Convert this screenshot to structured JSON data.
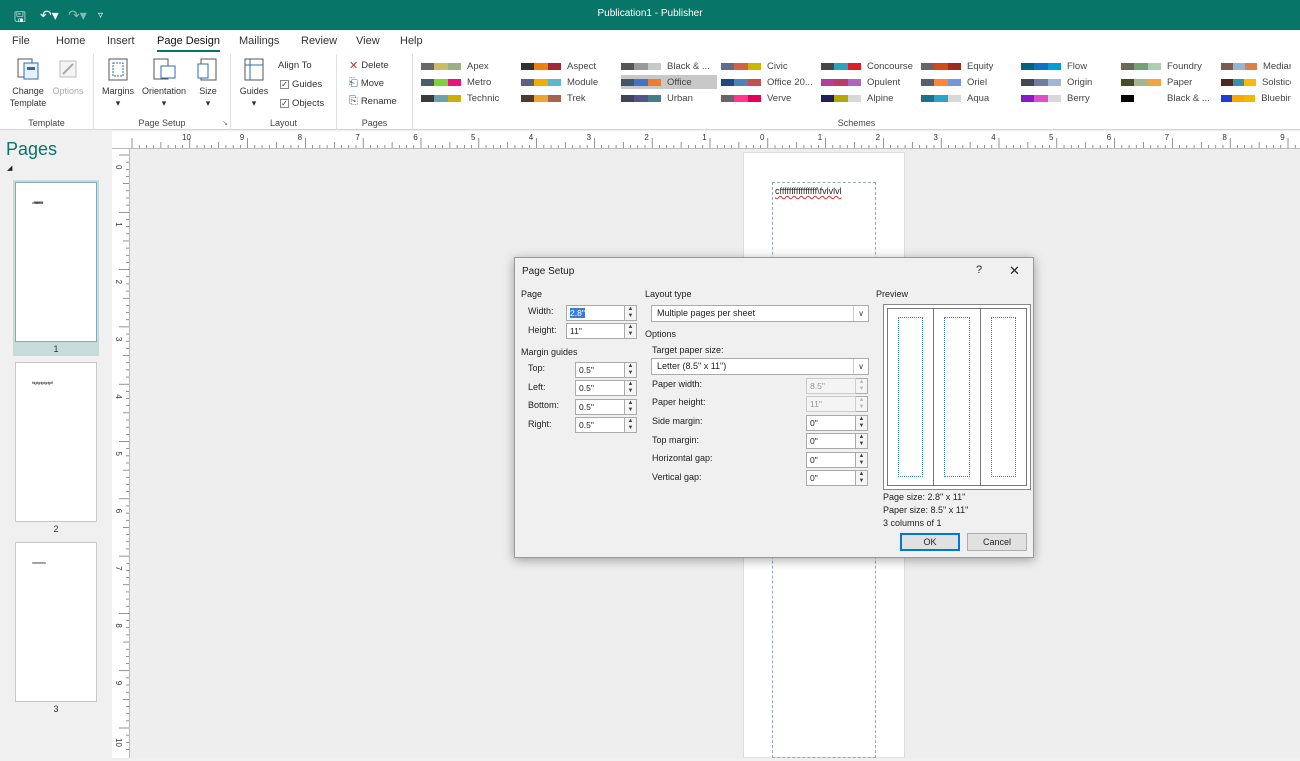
{
  "app": {
    "title": "Publication1 - Publisher"
  },
  "menu": {
    "tabs": [
      "File",
      "Home",
      "Insert",
      "Page Design",
      "Mailings",
      "Review",
      "View",
      "Help"
    ],
    "active": "Page Design"
  },
  "ribbon": {
    "template": {
      "change": "Change",
      "change2": "Template",
      "options": "Options",
      "label": "Template"
    },
    "page_setup": {
      "margins": "Margins",
      "orientation": "Orientation",
      "size": "Size",
      "label": "Page Setup"
    },
    "layout": {
      "guides": "Guides",
      "align_to": "Align To",
      "guides_chk": "Guides",
      "objects": "Objects",
      "label": "Layout"
    },
    "pages": {
      "delete": "Delete",
      "move": "Move",
      "rename": "Rename",
      "label": "Pages"
    },
    "schemes": {
      "label": "Schemes",
      "items": [
        {
          "name": "Apex",
          "colors": [
            "#69676d",
            "#ceb966",
            "#9cb084"
          ]
        },
        {
          "name": "Aspect",
          "colors": [
            "#323232",
            "#f07f09",
            "#9f2936"
          ]
        },
        {
          "name": "Black & ...",
          "colors": [
            "#555555",
            "#999999",
            "#c9c9c9"
          ]
        },
        {
          "name": "Civic",
          "colors": [
            "#646b86",
            "#d16349",
            "#ccb400"
          ]
        },
        {
          "name": "Concourse",
          "colors": [
            "#464646",
            "#2da2bf",
            "#da1f28"
          ]
        },
        {
          "name": "Equity",
          "colors": [
            "#696464",
            "#d34817",
            "#9b2d1f"
          ]
        },
        {
          "name": "Flow",
          "colors": [
            "#04617b",
            "#0f6fc6",
            "#009dd9"
          ]
        },
        {
          "name": "Foundry",
          "colors": [
            "#676a55",
            "#72a376",
            "#b0ccb0"
          ]
        },
        {
          "name": "Median",
          "colors": [
            "#775f55",
            "#94b6d2",
            "#dd8047"
          ]
        },
        {
          "name": "Metro",
          "colors": [
            "#4e5b6f",
            "#7fd13b",
            "#ea157a"
          ]
        },
        {
          "name": "Module",
          "colors": [
            "#5a6378",
            "#f0ad00",
            "#60b5cc"
          ]
        },
        {
          "name": "Office",
          "colors": [
            "#44546a",
            "#4472c4",
            "#ed7d31"
          ]
        },
        {
          "name": "Office 20...",
          "colors": [
            "#1f497d",
            "#4f81bd",
            "#c0504d"
          ]
        },
        {
          "name": "Opulent",
          "colors": [
            "#b13f9a",
            "#b83d68",
            "#ac66bb"
          ]
        },
        {
          "name": "Oriel",
          "colors": [
            "#575f6d",
            "#fe8637",
            "#7598d9"
          ]
        },
        {
          "name": "Origin",
          "colors": [
            "#464653",
            "#727ca3",
            "#9fb8cd"
          ]
        },
        {
          "name": "Paper",
          "colors": [
            "#444d26",
            "#a5b592",
            "#f3a447"
          ]
        },
        {
          "name": "Solstice",
          "colors": [
            "#4f271c",
            "#3891a7",
            "#feb80a"
          ]
        },
        {
          "name": "Technic",
          "colors": [
            "#3b3b3b",
            "#6ea0b0",
            "#ccaf0a"
          ]
        },
        {
          "name": "Trek",
          "colors": [
            "#4e3b30",
            "#f0a22e",
            "#a5644e"
          ]
        },
        {
          "name": "Urban",
          "colors": [
            "#424456",
            "#53548a",
            "#438086"
          ]
        },
        {
          "name": "Verve",
          "colors": [
            "#666666",
            "#ff388c",
            "#e40059"
          ]
        },
        {
          "name": "Alpine",
          "colors": [
            "#1f1f5c",
            "#b2a800",
            "#d8d8d8"
          ]
        },
        {
          "name": "Aqua",
          "colors": [
            "#1f6f8f",
            "#2ba4c9",
            "#d8d8d8"
          ]
        },
        {
          "name": "Berry",
          "colors": [
            "#8a1ac9",
            "#e04fc9",
            "#d8d8d8"
          ]
        },
        {
          "name": "Black & ...",
          "colors": [
            "#000000",
            "#ffffff",
            "#ffffff"
          ]
        },
        {
          "name": "Bluebird",
          "colors": [
            "#1e3cd8",
            "#f8a800",
            "#f0b800"
          ]
        }
      ],
      "selected": "Office"
    }
  },
  "pages_panel": {
    "title": "Pages",
    "pages": [
      {
        "num": "1",
        "text": "cfffffffffffffffff"
      },
      {
        "num": "2",
        "text": "fdgdgdgdgdgdf"
      },
      {
        "num": "3",
        "text": "xxxxxxxxx"
      }
    ]
  },
  "document": {
    "text": "cffffffffffffffff\\fvlvlvl"
  },
  "ruler": {
    "h": [
      "10",
      "9",
      "8",
      "7",
      "6",
      "5",
      "4",
      "3",
      "2",
      "1",
      "0",
      "1",
      "2",
      "3",
      "4",
      "5",
      "6",
      "7",
      "8",
      "9"
    ],
    "v": [
      "0",
      "1",
      "2",
      "3",
      "4",
      "5",
      "6",
      "7",
      "8",
      "9",
      "10"
    ]
  },
  "dialog": {
    "title": "Page Setup",
    "help": "?",
    "page_section": "Page",
    "width_label": "Width:",
    "width": "2.8\"",
    "height_label": "Height:",
    "height": "11\"",
    "margins_section": "Margin guides",
    "top_label": "Top:",
    "top": "0.5\"",
    "left_label": "Left:",
    "left": "0.5\"",
    "bottom_label": "Bottom:",
    "bottom": "0.5\"",
    "right_label": "Right:",
    "right": "0.5\"",
    "layout_section": "Layout type",
    "layout_value": "Multiple pages per sheet",
    "options_section": "Options",
    "target_label": "Target paper size:",
    "target_value": "Letter (8.5\" x 11\")",
    "paper_width_label": "Paper width:",
    "paper_width": "8.5\"",
    "paper_height_label": "Paper height:",
    "paper_height": "11\"",
    "side_margin_label": "Side margin:",
    "side_margin": "0\"",
    "top_margin_label": "Top margin:",
    "top_margin": "0\"",
    "hgap_label": "Horizontal gap:",
    "hgap": "0\"",
    "vgap_label": "Vertical gap:",
    "vgap": "0\"",
    "preview_section": "Preview",
    "page_size": "Page size: 2.8\" x 11\"",
    "paper_size": "Paper size: 8.5\" x 11\"",
    "columns": "3 columns of 1",
    "ok": "OK",
    "cancel": "Cancel"
  },
  "colors": {
    "accent": "#077568",
    "ok_border": "#0078d7"
  }
}
